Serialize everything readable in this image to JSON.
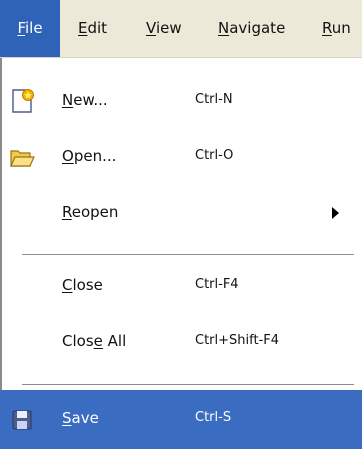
{
  "menubar": {
    "items": [
      {
        "label": "File",
        "mnemonic": "F",
        "rest": "ile"
      },
      {
        "label": "Edit",
        "mnemonic": "E",
        "rest": "dit"
      },
      {
        "label": "View",
        "mnemonic": "V",
        "rest": "iew"
      },
      {
        "label": "Navigate",
        "mnemonic": "N",
        "rest": "avigate"
      },
      {
        "label": "Run",
        "mnemonic": "R",
        "rest": "un"
      }
    ]
  },
  "file_menu": {
    "items": [
      {
        "label": "New...",
        "mnemonic": "N",
        "rest": "ew...",
        "shortcut": "Ctrl-N",
        "icon": "new-file-icon"
      },
      {
        "label": "Open...",
        "mnemonic": "O",
        "rest": "pen...",
        "shortcut": "Ctrl-O",
        "icon": "folder-open-icon"
      },
      {
        "label": "Reopen",
        "mnemonic": "R",
        "rest": "eopen",
        "shortcut": "",
        "submenu": true
      },
      {
        "label": "Close",
        "mnemonic": "C",
        "rest": "lose",
        "shortcut": "Ctrl-F4"
      },
      {
        "label": "Close All",
        "pre": "Clos",
        "mnemonic": "e",
        "rest": " All",
        "shortcut": "Ctrl+Shift-F4"
      },
      {
        "label": "Save",
        "mnemonic": "S",
        "rest": "ave",
        "shortcut": "Ctrl-S",
        "icon": "save-disk-icon",
        "selected": true
      }
    ]
  },
  "colors": {
    "menubar_bg": "#ece9d8",
    "active_menu": "#2f63b8",
    "selected_item": "#3a6dc2"
  }
}
